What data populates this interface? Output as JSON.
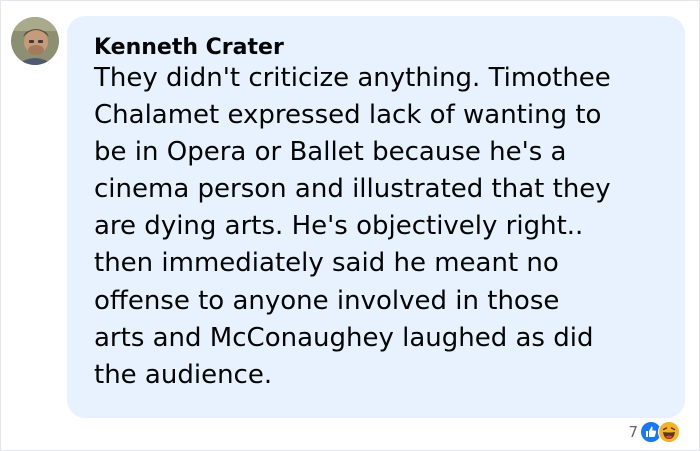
{
  "comment": {
    "author": "Kenneth Crater",
    "text": "They didn't criticize anything. Timothee\nChalamet expressed lack of wanting to\nbe in Opera or Ballet because he's a\ncinema person and illustrated that they\nare dying arts. He's objectively right..\nthen immediately said he meant no\noffense to anyone involved in those\narts and McConaughey laughed as did\nthe audience."
  },
  "reactions": {
    "count": "7",
    "icons": [
      "like-icon",
      "haha-icon"
    ],
    "colors": {
      "like": "#1877f2",
      "haha": "#f7b125"
    }
  },
  "colors": {
    "bubble": "#e7f2fe",
    "text": "#050505"
  }
}
